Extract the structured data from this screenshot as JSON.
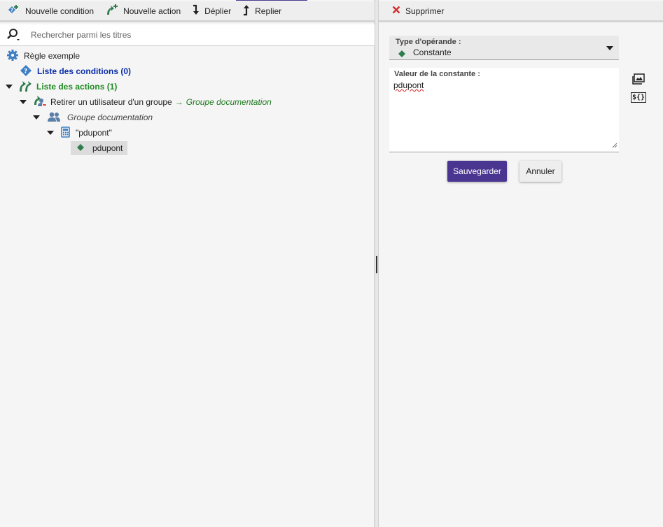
{
  "left_toolbar": {
    "new_condition": "Nouvelle condition",
    "new_action": "Nouvelle action",
    "expand": "Déplier",
    "collapse": "Replier"
  },
  "search": {
    "placeholder": "Rechercher parmi les titres"
  },
  "tree": {
    "root": "Règle exemple",
    "conditions": "Liste des conditions (0)",
    "actions": "Liste des actions (1)",
    "action_item": "Retirer un utilisateur d'un groupe",
    "action_arrow": "→",
    "action_target": "Groupe documentation",
    "group_node": "Groupe documentation",
    "formula_node": "\"pdupont\"",
    "constant_node": "pdupont"
  },
  "right_toolbar": {
    "delete": "Supprimer"
  },
  "operand_type": {
    "label": "Type d'opérande :",
    "value": "Constante"
  },
  "constant_value": {
    "label": "Valeur de la constante :",
    "value": "pdupont"
  },
  "side_icons": {
    "variable": "${}"
  },
  "actions": {
    "save": "Sauvegarder",
    "cancel": "Annuler"
  },
  "colors": {
    "accent": "#4a3691",
    "conditions": "#0b2ea8",
    "actions": "#1f8a22",
    "delete": "#d32f2f",
    "constant": "#2e7d4f"
  }
}
